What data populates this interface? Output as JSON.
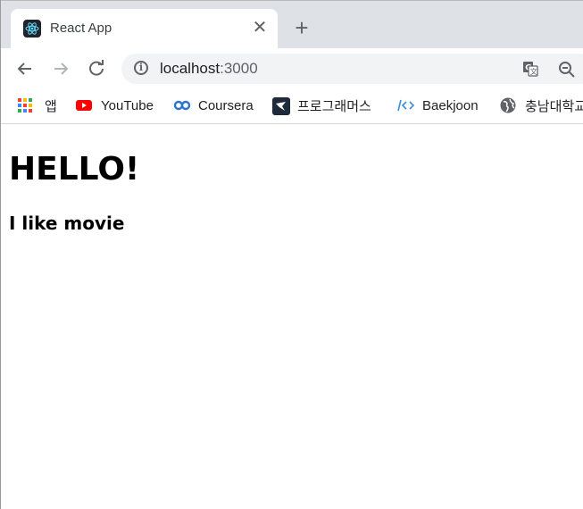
{
  "browser": {
    "tab": {
      "title": "React App"
    },
    "toolbar": {
      "url_host": "localhost",
      "url_port": ":3000"
    },
    "bookmarks": [
      {
        "label": "앱",
        "icon": "apps-grid-icon"
      },
      {
        "label": "YouTube",
        "icon": "youtube-icon"
      },
      {
        "label": "Coursera",
        "icon": "coursera-icon"
      },
      {
        "label": "프로그래머스",
        "icon": "programmers-icon"
      },
      {
        "label": "Baekjoon",
        "icon": "baekjoon-icon"
      },
      {
        "label": "충남대학교",
        "icon": "globe-icon"
      }
    ]
  },
  "page": {
    "heading": "HELLO!",
    "subheading": "I like movie"
  },
  "colors": {
    "tabstrip": "#dee1e6",
    "omnibox": "#f1f3f4",
    "react_blue": "#61dafb",
    "youtube_red": "#ff0000",
    "coursera_blue": "#2a73cc"
  }
}
